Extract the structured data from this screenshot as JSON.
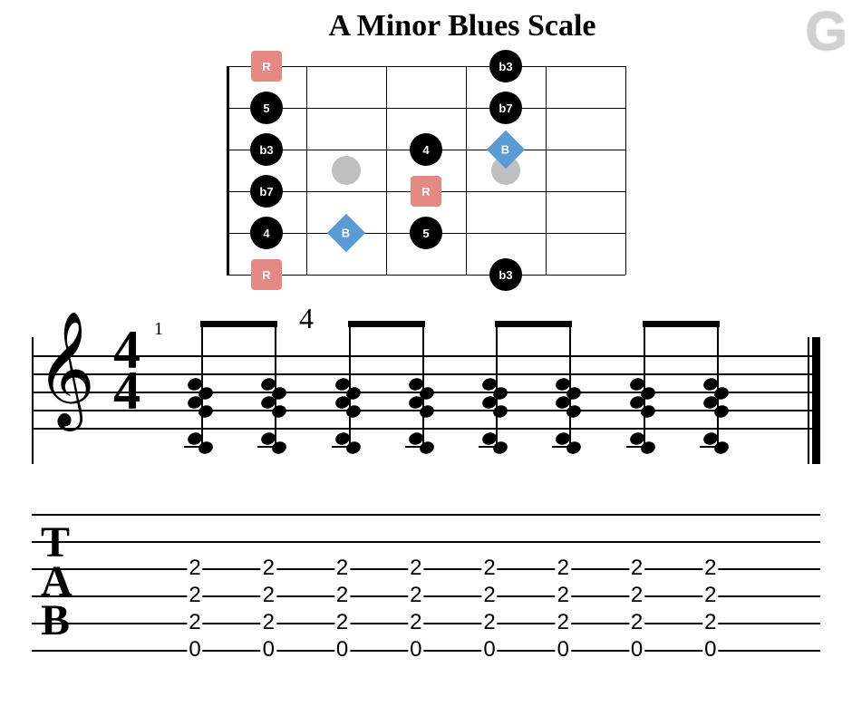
{
  "title": "A Minor Blues Scale",
  "watermark": "G",
  "fretboard": {
    "strings": 6,
    "frets": 5,
    "inlays": [
      {
        "fret": 2,
        "between_strings": [
          2,
          3
        ]
      },
      {
        "fret": 4,
        "between_strings": [
          2,
          3
        ]
      }
    ],
    "notes": [
      {
        "string": 0,
        "fret": 1,
        "label": "R",
        "type": "root"
      },
      {
        "string": 0,
        "fret": 4,
        "label": "b3",
        "type": "black"
      },
      {
        "string": 1,
        "fret": 1,
        "label": "5",
        "type": "black"
      },
      {
        "string": 1,
        "fret": 4,
        "label": "b7",
        "type": "black"
      },
      {
        "string": 2,
        "fret": 1,
        "label": "b3",
        "type": "black"
      },
      {
        "string": 2,
        "fret": 3,
        "label": "4",
        "type": "black"
      },
      {
        "string": 2,
        "fret": 4,
        "label": "B",
        "type": "blue"
      },
      {
        "string": 3,
        "fret": 1,
        "label": "b7",
        "type": "black"
      },
      {
        "string": 3,
        "fret": 3,
        "label": "R",
        "type": "root"
      },
      {
        "string": 4,
        "fret": 1,
        "label": "4",
        "type": "black"
      },
      {
        "string": 4,
        "fret": 2,
        "label": "B",
        "type": "blue"
      },
      {
        "string": 4,
        "fret": 3,
        "label": "5",
        "type": "black"
      },
      {
        "string": 5,
        "fret": 1,
        "label": "R",
        "type": "root"
      },
      {
        "string": 5,
        "fret": 4,
        "label": "b3",
        "type": "black"
      }
    ]
  },
  "notation": {
    "bar_number": "4",
    "measure_label": "1",
    "time_signature_num": "4",
    "time_signature_den": "4",
    "beats": 8,
    "beat_groups": 4
  },
  "tab": {
    "label_t": "T",
    "label_a": "A",
    "label_b": "B",
    "columns": [
      {
        "strings": [
          null,
          null,
          "2",
          "2",
          "2",
          "0"
        ]
      },
      {
        "strings": [
          null,
          null,
          "2",
          "2",
          "2",
          "0"
        ]
      },
      {
        "strings": [
          null,
          null,
          "2",
          "2",
          "2",
          "0"
        ]
      },
      {
        "strings": [
          null,
          null,
          "2",
          "2",
          "2",
          "0"
        ]
      },
      {
        "strings": [
          null,
          null,
          "2",
          "2",
          "2",
          "0"
        ]
      },
      {
        "strings": [
          null,
          null,
          "2",
          "2",
          "2",
          "0"
        ]
      },
      {
        "strings": [
          null,
          null,
          "2",
          "2",
          "2",
          "0"
        ]
      },
      {
        "strings": [
          null,
          null,
          "2",
          "2",
          "2",
          "0"
        ]
      }
    ]
  }
}
